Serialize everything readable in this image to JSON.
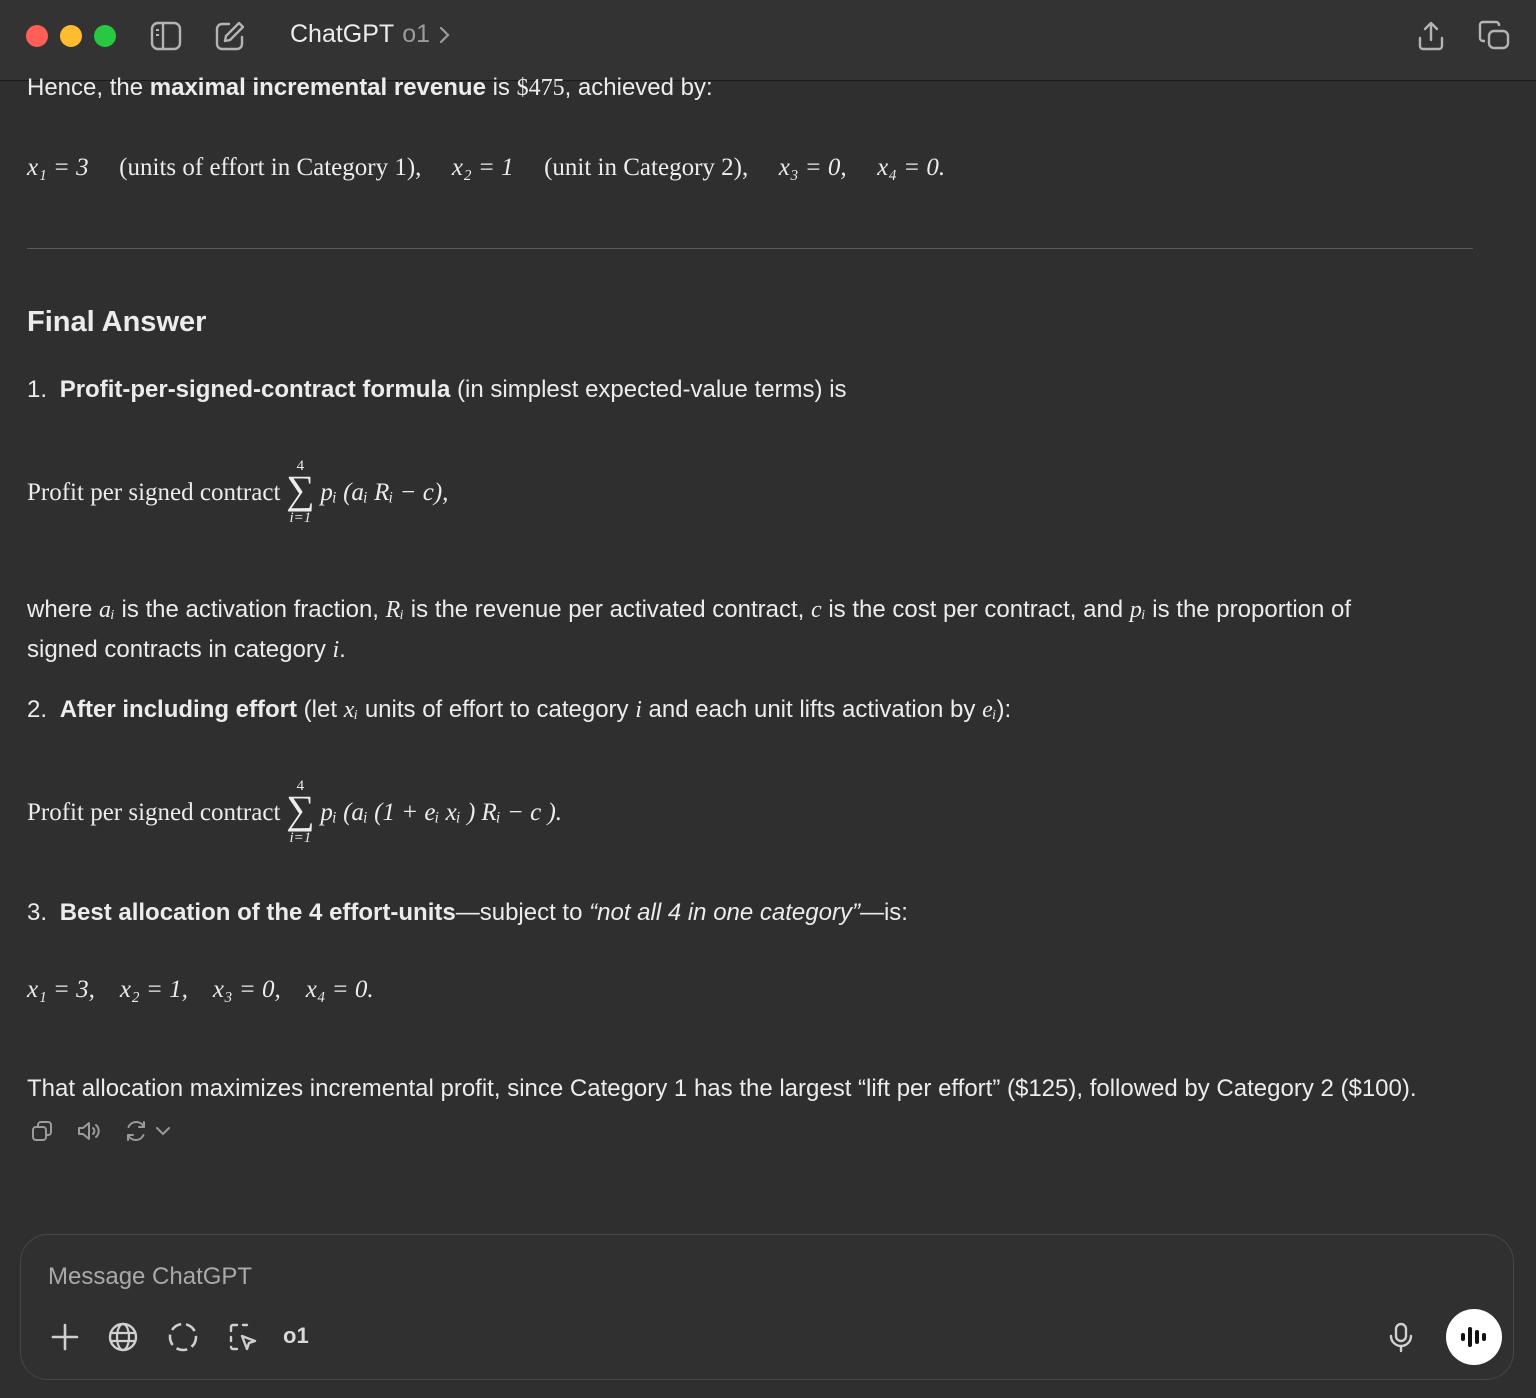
{
  "window": {
    "title": "ChatGPT",
    "model": "o1",
    "traffic_lights": {
      "close": "#ff5f57",
      "minimize": "#febc2e",
      "zoom": "#28c840"
    }
  },
  "message": {
    "intro": {
      "prefix": "Hence, the ",
      "bold": "maximal incremental revenue",
      "middle": " is ",
      "amount": "$475",
      "suffix": ", achieved by:"
    },
    "alloc_math": {
      "x1": "x₁ = 3",
      "x1_note": "(units of effort in Category 1),",
      "x2": "x₂ = 1",
      "x2_note": "(unit in Category 2),",
      "x3": "x₃ = 0,",
      "x4": "x₄ = 0."
    },
    "heading": "Final Answer",
    "item1": {
      "number": "1.",
      "bold": "Profit-per-signed-contract formula",
      "rest": " (in simplest expected-value terms) is",
      "formula_prefix": "Profit per signed contract",
      "sum_top": "4",
      "sum_bottom": "i=1",
      "formula_body": "pᵢ (aᵢ Rᵢ − c),"
    },
    "where": {
      "t1": "where ",
      "v1": "aᵢ",
      "t2": " is the activation fraction, ",
      "v2": "Rᵢ",
      "t3": " is the revenue per activated contract, ",
      "v3": "c",
      "t4": " is the cost per contract, and ",
      "v4": "pᵢ",
      "t5": " is the proportion of",
      "t6": "signed contracts in category ",
      "v5": "i",
      "t7": "."
    },
    "item2": {
      "number": "2.",
      "bold": "After including effort",
      "t1": " (let ",
      "v1": "xᵢ",
      "t2": " units of effort to category ",
      "v2": "i",
      "t3": " and each unit lifts activation by ",
      "v3": "eᵢ",
      "t4": "):",
      "formula_prefix": "Profit per signed contract",
      "sum_top": "4",
      "sum_bottom": "i=1",
      "formula_body": "pᵢ (aᵢ (1 + eᵢ xᵢ ) Rᵢ − c )."
    },
    "item3": {
      "number": "3.",
      "bold": "Best allocation of the 4 effort-units",
      "t1": "—subject to ",
      "italic": "“not all 4 in one category”",
      "t2": "—is:",
      "math": "x₁ = 3,    x₂ = 1,    x₃ = 0,    x₄ = 0."
    },
    "conclusion": "That allocation maximizes incremental profit, since Category 1 has the largest “lift per effort” ($125), followed by Category 2 ($100)."
  },
  "actions": [
    "copy-icon",
    "read-aloud-icon",
    "regenerate-icon",
    "chevron-down-icon"
  ],
  "composer": {
    "placeholder": "Message ChatGPT",
    "model_label": "o1",
    "tools": [
      "plus-icon",
      "globe-icon",
      "dashed-circle-icon",
      "cursor-select-icon"
    ]
  }
}
